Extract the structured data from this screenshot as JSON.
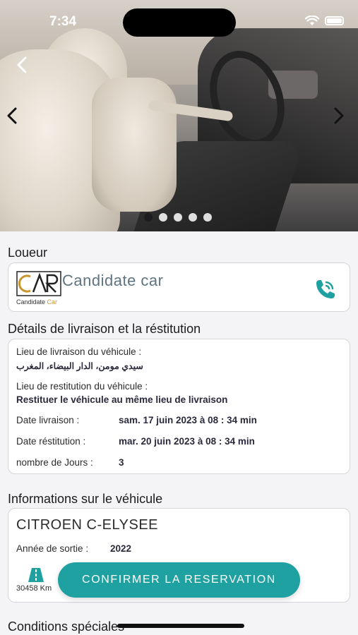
{
  "status_bar": {
    "time": "7:34"
  },
  "carousel": {
    "slides": 5,
    "active_index": 0
  },
  "loueur": {
    "section_title": "Loueur",
    "logo_text": "CAR",
    "logo_caption_prefix": "Candidate ",
    "logo_caption_accent": "Car",
    "company_name": "Candidate car"
  },
  "livraison": {
    "section_title": "Détails de livraison et la réstitution",
    "lieu_livraison_label": "Lieu de livraison du véhicule :",
    "lieu_livraison_value": "سيدي مومن، الدار البيضاء، المغرب",
    "lieu_restitution_label": "Lieu de restitution du véhicule :",
    "lieu_restitution_value": "Restituer le véhicule au même lieu de livraison",
    "date_livraison_label": "Date livraison :",
    "date_livraison_value": "sam. 17 juin 2023 à 08 : 34  min",
    "date_restitution_label": "Date réstitution :",
    "date_restitution_value": "mar. 20 juin 2023 à 08 : 34  min",
    "nombre_jours_label": "nombre de Jours :",
    "nombre_jours_value": "3"
  },
  "vehicule": {
    "section_title": "Informations sur le véhicule",
    "name": "CITROEN C-ELYSEE",
    "annee_label": "Année de sortie :",
    "annee_value": "2022",
    "km_value": "30458 Km"
  },
  "conditions": {
    "section_title": "Conditions spéciales"
  },
  "cta": {
    "label": "CONFIRMER LA RESERVATION"
  },
  "colors": {
    "accent": "#1fa0a1",
    "company_text": "#5f7482",
    "logo_gold": "#c7962f"
  }
}
